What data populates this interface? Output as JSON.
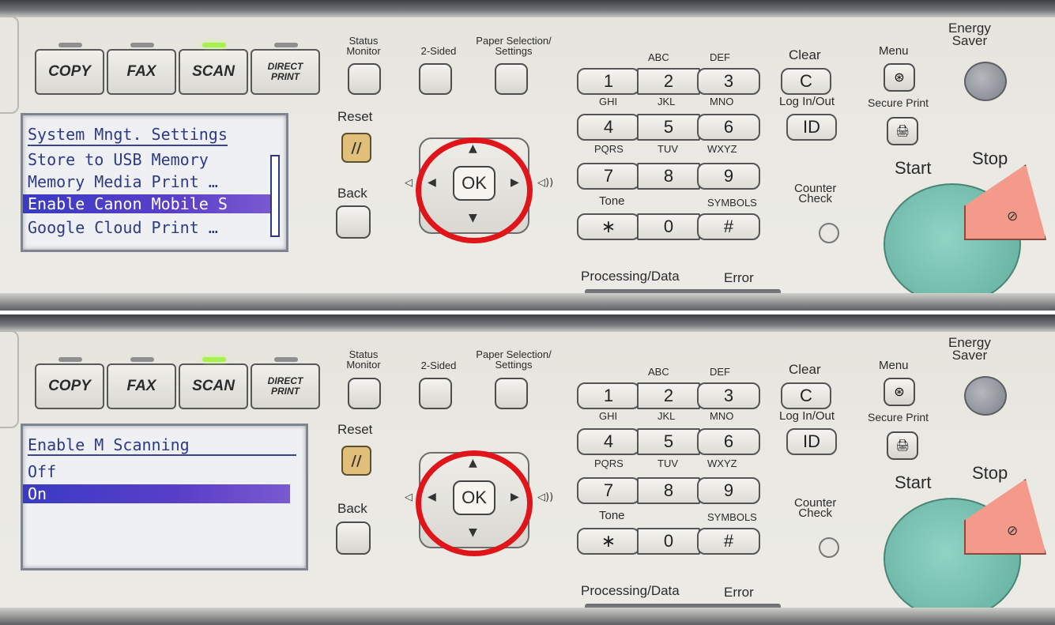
{
  "mode_buttons": [
    "COPY",
    "FAX",
    "SCAN",
    "DIRECT\nPRINT"
  ],
  "labels": {
    "status_monitor": "Status\nMonitor",
    "two_sided": "2-Sided",
    "paper_selection": "Paper Selection/\nSettings",
    "reset": "Reset",
    "back": "Back",
    "ok": "OK",
    "clear": "Clear",
    "log_in_out": "Log In/Out",
    "menu": "Menu",
    "secure_print": "Secure Print",
    "energy_saver": "Energy\nSaver",
    "start": "Start",
    "stop": "Stop",
    "counter_check": "Counter\nCheck",
    "processing_data": "Processing/Data",
    "error": "Error",
    "tone": "Tone",
    "symbols": "SYMBOLS",
    "clear_key": "C",
    "id_key": "ID"
  },
  "keypad": {
    "letters_row1": [
      "ABC",
      "DEF"
    ],
    "letters_row2": [
      "GHI",
      "JKL",
      "MNO"
    ],
    "letters_row3": [
      "PQRS",
      "TUV",
      "WXYZ"
    ],
    "row1": [
      "1",
      "2",
      "3"
    ],
    "row2": [
      "4",
      "5",
      "6"
    ],
    "row3": [
      "7",
      "8",
      "9"
    ],
    "row4": [
      "∗",
      "0",
      "#"
    ]
  },
  "screens": {
    "top": {
      "title": "System Mngt. Settings",
      "items": [
        "Store to USB Memory",
        "Memory Media Print …",
        "Enable Canon Mobile S",
        "Google Cloud Print …"
      ],
      "selected_index": 2
    },
    "bottom": {
      "title": "Enable M Scanning",
      "items": [
        "Off",
        "On"
      ],
      "selected_index": 1
    }
  },
  "annotation_color": "#e0151a"
}
